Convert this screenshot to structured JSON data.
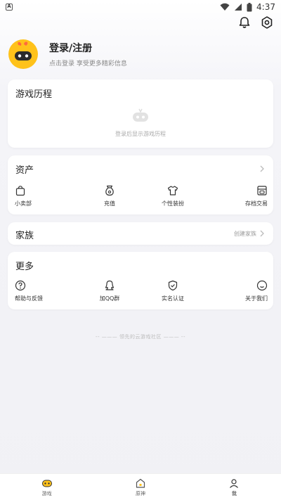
{
  "status_bar": {
    "time": "4:37"
  },
  "profile": {
    "title": "登录/注册",
    "subtitle": "点击登录 享受更多精彩信息"
  },
  "history": {
    "title": "游戏历程",
    "empty_text": "登录后显示游戏历程"
  },
  "assets": {
    "title": "资产",
    "items": [
      {
        "label": "小卖部",
        "icon": "bag-icon"
      },
      {
        "label": "充值",
        "icon": "money-bag-icon"
      },
      {
        "label": "个性装扮",
        "icon": "shirt-icon"
      },
      {
        "label": "存档交易",
        "icon": "archive-icon"
      }
    ]
  },
  "family": {
    "title": "家族",
    "extra": "创建家族"
  },
  "more": {
    "title": "更多",
    "items": [
      {
        "label": "帮助与反馈",
        "icon": "help-icon"
      },
      {
        "label": "加QQ群",
        "icon": "qq-icon"
      },
      {
        "label": "实名认证",
        "icon": "shield-icon"
      },
      {
        "label": "关于我们",
        "icon": "about-icon"
      }
    ]
  },
  "slogan": "-- ——— 领先的云游戏社区 ——— --",
  "tabs": [
    {
      "label": "游戏",
      "icon": "gamepad-icon"
    },
    {
      "label": "原神",
      "icon": "home-icon"
    },
    {
      "label": "我",
      "icon": "me-icon"
    }
  ],
  "colors": {
    "accent": "#ffc21a",
    "background": "#f1f1f5",
    "card": "#ffffff"
  }
}
